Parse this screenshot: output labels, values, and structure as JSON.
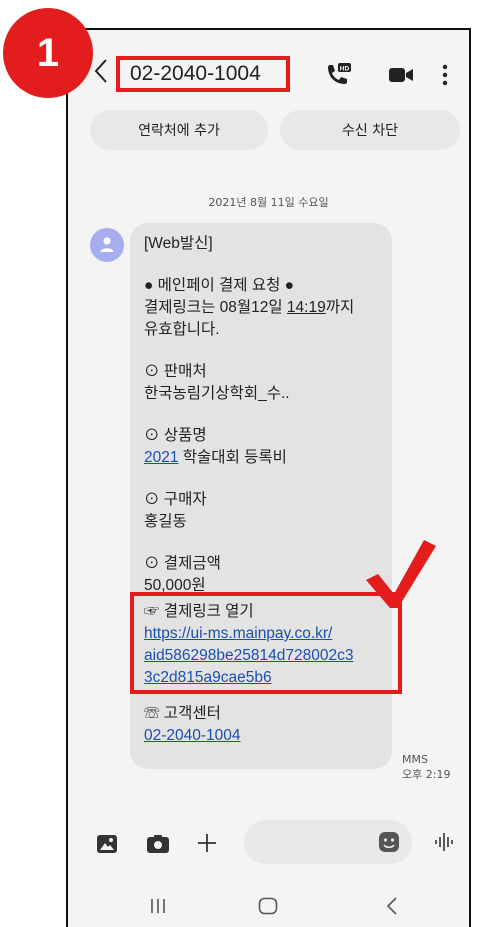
{
  "step_badge": "1",
  "header": {
    "phone_number": "02-2040-1004",
    "call_icon_badge": "HD"
  },
  "actions": {
    "add_contact": "연락처에 추가",
    "block": "수신 차단"
  },
  "date_label": "2021년 8월 11일 수요일",
  "message": {
    "sender_tag": "[Web발신]",
    "title": "● 메인페이 결제 요청 ●",
    "expiry_pre": "결제링크는 08월12일 ",
    "expiry_time": "14:19",
    "expiry_post": "까지",
    "expiry_line2": "유효합니다.",
    "seller_label": "⊙ 판매처",
    "seller_value": "한국농림기상학회_수..",
    "product_label": "⊙ 상품명",
    "product_year": "2021",
    "product_rest": " 학술대회 등록비",
    "buyer_label": "⊙ 구매자",
    "buyer_value": "홍길동",
    "amount_label": "⊙ 결제금액",
    "amount_value": "50,000원",
    "link_label": "☞ 결제링크 열기",
    "link_line1": "https://ui-ms.mainpay.co.kr/",
    "link_line2": "aid586298be25814d728002c3",
    "link_line3": "3c2d815a9cae5b6",
    "cs_label": "☏ 고객센터",
    "cs_number": "02-2040-1004"
  },
  "meta": {
    "type": "MMS",
    "time": "오후 2:19"
  },
  "colors": {
    "accent_red": "#e31d1d",
    "link_blue": "#1a4fb0",
    "avatar": "#a7aef0"
  }
}
